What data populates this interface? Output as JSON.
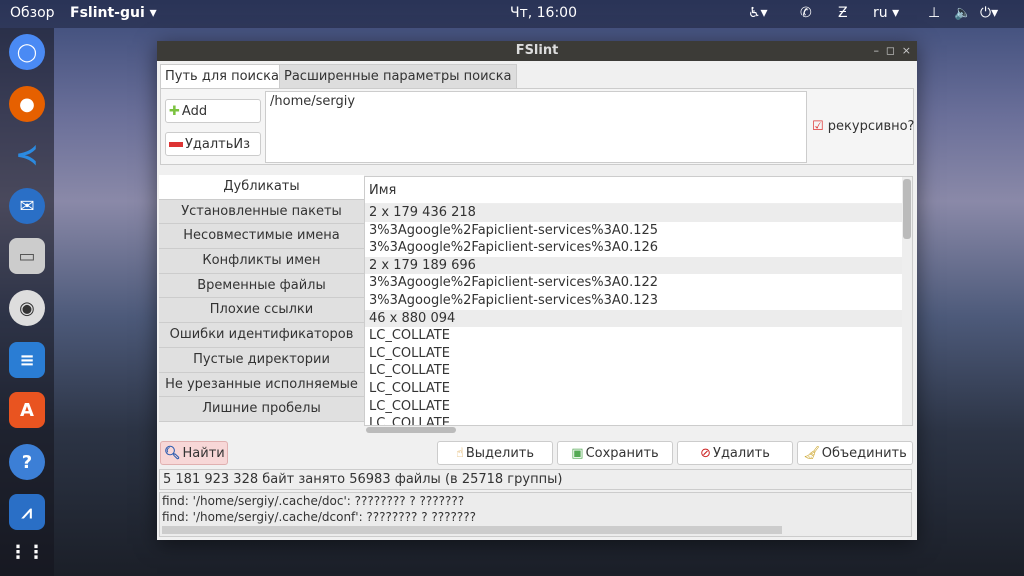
{
  "topbar": {
    "overview": "Обзор",
    "app": "Fslint-gui ▾",
    "clock": "Чт, 16:00",
    "lang": "ru ▾"
  },
  "window": {
    "title": "FSlint",
    "min": "–",
    "max": "◻",
    "close": "×"
  },
  "tabs": [
    "Путь для поиска",
    "Расширенные параметры поиска"
  ],
  "path_panel": {
    "add": "Add",
    "remove": "УдалтьИз",
    "path": "/home/sergiy",
    "recursive": "рекурсивно?"
  },
  "side_tabs": [
    "Дубликаты",
    "Установленные пакеты",
    "Несовместимые имена",
    "Конфликты имен",
    "Временные файлы",
    "Плохие ссылки",
    "Ошибки идентификаторов",
    "Пустые директории",
    "Не урезанные исполняемые",
    "Лишние пробелы"
  ],
  "list": {
    "header": "Имя",
    "rows": [
      {
        "text": "2 x 179 436 218",
        "group": true
      },
      {
        "text": "3%3Agoogle%2Fapiclient-services%3A0.125",
        "group": false
      },
      {
        "text": "3%3Agoogle%2Fapiclient-services%3A0.126",
        "group": false
      },
      {
        "text": "2 x 179 189 696",
        "group": true
      },
      {
        "text": "3%3Agoogle%2Fapiclient-services%3A0.122",
        "group": false
      },
      {
        "text": "3%3Agoogle%2Fapiclient-services%3A0.123",
        "group": false
      },
      {
        "text": "46 x 880 094",
        "group": true
      },
      {
        "text": "LC_COLLATE",
        "group": false
      },
      {
        "text": "LC_COLLATE",
        "group": false
      },
      {
        "text": "LC_COLLATE",
        "group": false
      },
      {
        "text": "LC_COLLATE",
        "group": false
      },
      {
        "text": "LC_COLLATE",
        "group": false
      },
      {
        "text": "LC_COLLATE",
        "group": false
      }
    ]
  },
  "actions": {
    "find": "Найти",
    "select": "Выделить",
    "save": "Сохранить",
    "delete": "Удалить",
    "merge": "Объединить"
  },
  "status": "5 181 923 328 байт занято 56983 файлы (в 25718 группы)",
  "log": [
    "find: '/home/sergiy/.cache/doc': ???????? ? ???????",
    "find: '/home/sergiy/.cache/dconf': ???????? ? ???????"
  ]
}
